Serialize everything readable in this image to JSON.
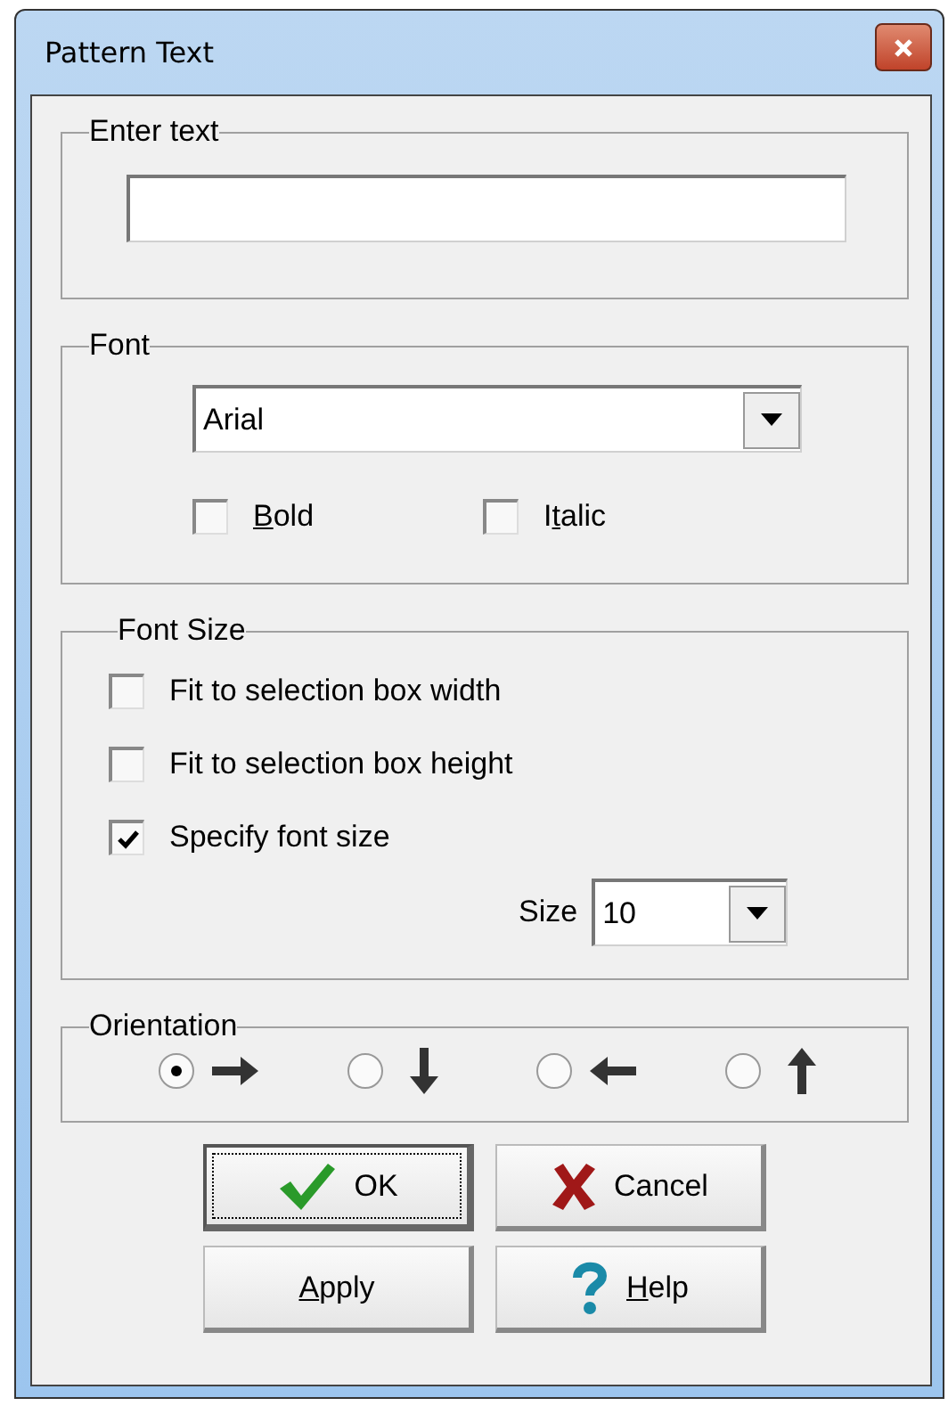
{
  "window": {
    "title": "Pattern Text"
  },
  "enter_text": {
    "legend": "Enter text"
  },
  "font": {
    "legend": "Font",
    "font_name": "Arial",
    "styles": [
      {
        "parts": [
          {
            "text": "B",
            "underline": true
          },
          {
            "text": "old",
            "underline": false
          }
        ],
        "checked": false
      },
      {
        "parts": [
          {
            "text": "I",
            "underline": false
          },
          {
            "text": "t",
            "underline": true
          },
          {
            "text": "alic",
            "underline": false
          }
        ],
        "checked": false
      }
    ]
  },
  "font_size": {
    "legend": "Font Size",
    "options": [
      {
        "label": "Fit to selection box width",
        "checked": false
      },
      {
        "label": "Fit to selection box height",
        "checked": false
      },
      {
        "label": "Specify font size",
        "checked": true
      }
    ],
    "size_label": "Size",
    "size": "10"
  },
  "orientation": {
    "legend": "Orientation",
    "options": [
      {
        "kind": "right",
        "selected": true
      },
      {
        "kind": "down",
        "selected": false
      },
      {
        "kind": "left",
        "selected": false
      },
      {
        "kind": "up",
        "selected": false
      }
    ]
  },
  "buttons": [
    {
      "kind": "ok",
      "parts": [
        {
          "text": "OK",
          "underline": false
        }
      ],
      "focused": true
    },
    {
      "kind": "cancel",
      "parts": [
        {
          "text": "Cancel",
          "underline": false
        }
      ],
      "focused": false
    },
    {
      "kind": "apply",
      "parts": [
        {
          "text": "A",
          "underline": true
        },
        {
          "text": "pply",
          "underline": false
        }
      ],
      "focused": false
    },
    {
      "kind": "help",
      "parts": [
        {
          "text": "H",
          "underline": true
        },
        {
          "text": "elp",
          "underline": false
        }
      ],
      "focused": false
    }
  ]
}
